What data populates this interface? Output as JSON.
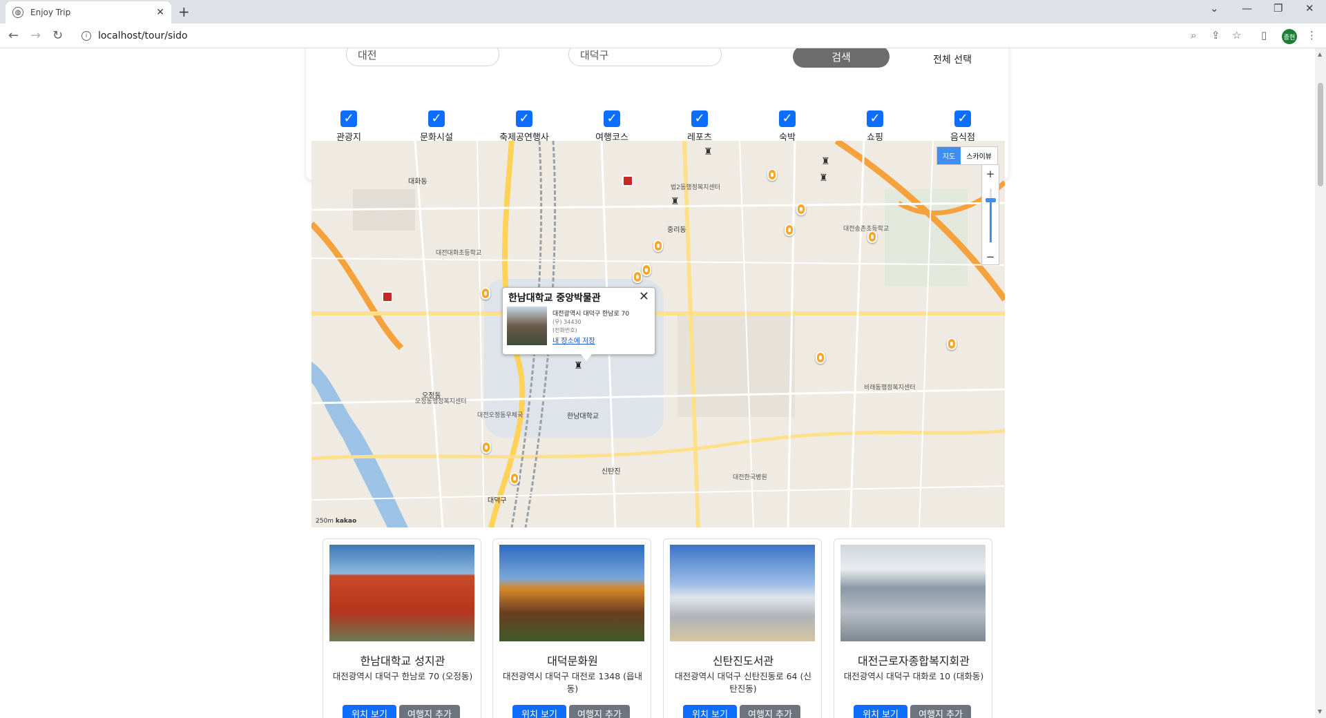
{
  "browser": {
    "tab_title": "Enjoy Trip",
    "url": "localhost/tour/sido",
    "profile_initials": "종현"
  },
  "filter": {
    "sido_value": "대전",
    "gugun_value": "대덕구",
    "search_label": "검색",
    "select_all_label": "전체 선택",
    "categories": [
      {
        "label": "관광지",
        "checked": true
      },
      {
        "label": "문화시설",
        "checked": true
      },
      {
        "label": "축제공연행사",
        "checked": true
      },
      {
        "label": "여행코스",
        "checked": true
      },
      {
        "label": "레포츠",
        "checked": true
      },
      {
        "label": "숙박",
        "checked": true
      },
      {
        "label": "쇼핑",
        "checked": true
      },
      {
        "label": "음식점",
        "checked": true
      }
    ]
  },
  "map": {
    "type_map": "지도",
    "type_sky": "스카이뷰",
    "zoom_in": "+",
    "zoom_out": "−",
    "scale": "250m",
    "logo": "kakao",
    "labels": [
      "대화동",
      "대전대화초등학교",
      "오정동",
      "한남대학교",
      "대전오정동우체국",
      "신탄진",
      "중리동",
      "법2동행정복지센터",
      "대전송촌초등학교",
      "비래동행정복지센터",
      "대전한국병원",
      "오정동행정복지센터",
      "대덕구"
    ],
    "popup": {
      "title": "한남대학교 중앙박물관",
      "address": "대전광역시 대덕구 한남로 70",
      "zip": "(우) 34430",
      "tel": "(전화번호)",
      "save_link": "내 장소에 저장"
    }
  },
  "cards": [
    {
      "name": "한남대학교 성지관",
      "address": "대전광역시 대덕구 한남로 70 (오정동)",
      "btn_location": "위치 보기",
      "btn_add": "여행지 추가"
    },
    {
      "name": "대덕문화원",
      "address": "대전광역시 대덕구 대전로 1348 (읍내동)",
      "btn_location": "위치 보기",
      "btn_add": "여행지 추가"
    },
    {
      "name": "신탄진도서관",
      "address": "대전광역시 대덕구 신탄진동로 64 (신탄진동)",
      "btn_location": "위치 보기",
      "btn_add": "여행지 추가"
    },
    {
      "name": "대전근로자종합복지회관",
      "address": "대전광역시 대덕구 대화로 10 (대화동)",
      "btn_location": "위치 보기",
      "btn_add": "여행지 추가"
    }
  ]
}
